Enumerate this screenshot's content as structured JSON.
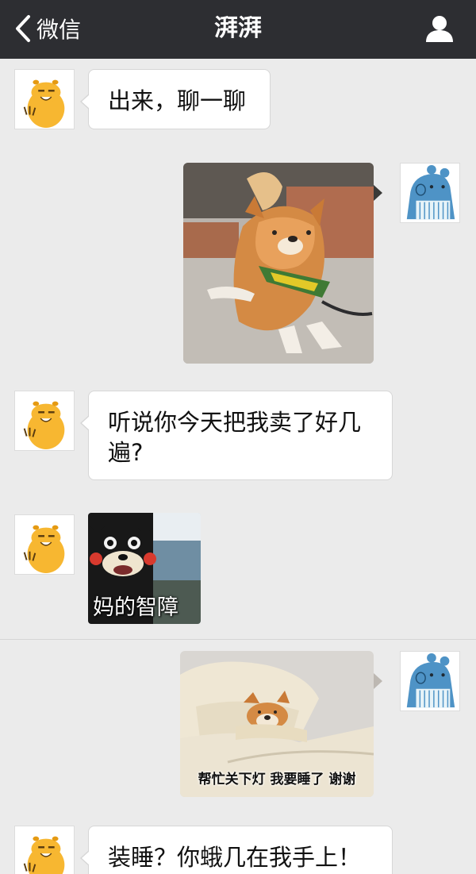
{
  "navbar": {
    "back_label": "微信",
    "title": "湃湃"
  },
  "messages": [
    {
      "side": "left",
      "type": "text",
      "text": "出来，聊一聊"
    },
    {
      "side": "right",
      "type": "image",
      "image": "shiba-stretching-photo"
    },
    {
      "side": "left",
      "type": "text",
      "text_lines": [
        "听说你今天把我卖了好几",
        "遍?"
      ]
    },
    {
      "side": "left",
      "type": "image",
      "image": "kumamon-meme",
      "caption": "妈的智障"
    },
    {
      "side": "right",
      "type": "image",
      "image": "shiba-in-bed-meme",
      "caption": "帮忙关下灯 我要睡了 谢谢"
    },
    {
      "side": "left",
      "type": "text",
      "text": "装睡？你蛾几在我手上！"
    }
  ],
  "icons": {
    "back": "chevron-left-icon",
    "profile": "person-icon",
    "left_avatar": "capybara-avatar",
    "right_avatar": "blue-creature-avatar"
  },
  "colors": {
    "navbar": "#2d2e32",
    "chat_background": "#ebebeb",
    "bubble": "#ffffff"
  }
}
